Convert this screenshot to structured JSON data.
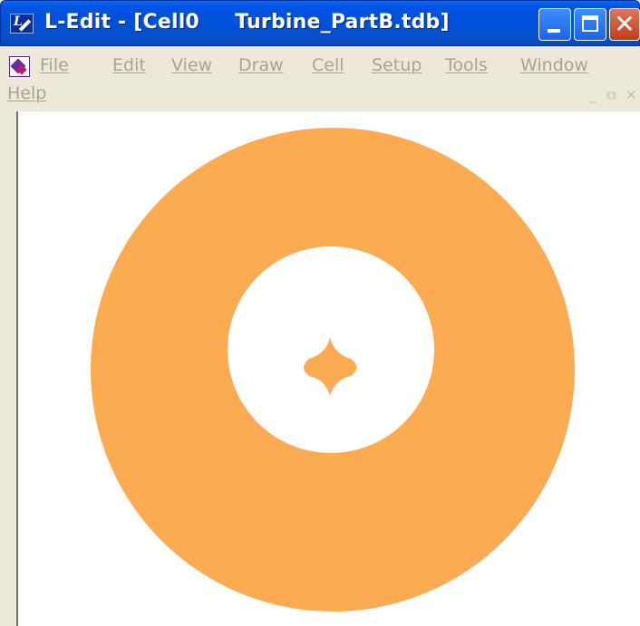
{
  "window": {
    "title": "L-Edit - [Cell0     Turbine_PartB.tdb]",
    "app_icon": "l-edit-app-icon",
    "buttons": {
      "minimize": "minimize",
      "maximize": "maximize",
      "close": "✕"
    }
  },
  "menu": {
    "items": [
      "File",
      "Edit",
      "View",
      "Draw",
      "Cell",
      "Setup",
      "Tools",
      "Window",
      "Help"
    ],
    "doc_icon": "layout-document-icon",
    "mdi_controls": [
      "_",
      "⧉",
      "✕"
    ]
  },
  "canvas": {
    "background": "#ffffff",
    "shapes": [
      {
        "type": "annulus-ring",
        "color": "#fdab53"
      },
      {
        "type": "center-star",
        "color": "#fdab53"
      }
    ]
  },
  "colors": {
    "titlebar": "#0054e3",
    "menu_bg": "#ece9d8",
    "menu_text_disabled": "#a6a49a",
    "shape_fill": "#fdab53"
  }
}
